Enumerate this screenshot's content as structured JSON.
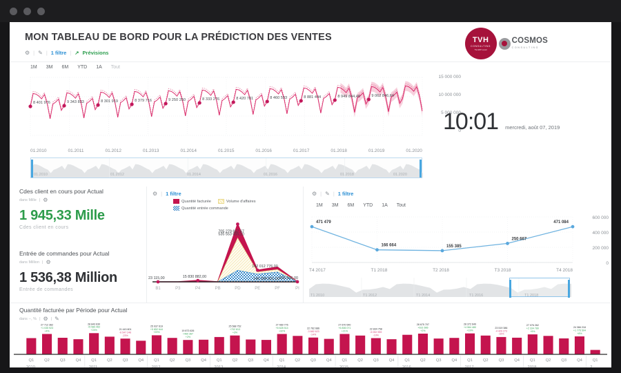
{
  "window": {
    "dots": [
      "close",
      "minimize",
      "maximize"
    ]
  },
  "header": {
    "title": "MON TABLEAU DE BORD POUR LA PRÉDICTION DES VENTES",
    "toolbar": {
      "gear_icon": "gear-icon",
      "edit_icon": "pencil-icon",
      "filter_label": "1 filtre",
      "forecast_icon": "trend-up-icon",
      "forecast_label": "Prévisions",
      "separator": "|"
    },
    "brand": {
      "tvh_line1": "TVH",
      "tvh_line2": "CONSULTING",
      "tvh_line3": "The ERP expert",
      "cosmos_line1": "COSMOS",
      "cosmos_line2": "CONSULTING"
    }
  },
  "clock": {
    "time": "10:01",
    "date": "mercredi, août 07, 2019"
  },
  "range_tabs": [
    "1M",
    "3M",
    "6M",
    "YTD",
    "1A",
    "Tout"
  ],
  "range_tabs_active_index": 5,
  "kpi_cards": [
    {
      "title": "Cdes client en cours pour Actual",
      "unit": "dans Mille",
      "gear_icon": "gear-icon",
      "value": "1 945,33 Mille",
      "caption": "Cdes client en cours",
      "color": "#2d9c4b"
    },
    {
      "title": "Entrée de commandes pour Actual",
      "unit": "dans Million",
      "gear_icon": "gear-icon",
      "value": "1 536,38 Million",
      "caption": "Entrée de commandes",
      "color": "#2f3135"
    }
  ],
  "mid_panel": {
    "gear_icon": "gear-icon",
    "filter_label": "1 filtre",
    "separator": "|"
  },
  "right_panel": {
    "gear_icon": "gear-icon",
    "edit_icon": "pencil-icon",
    "filter_label": "1 filtre",
    "separator": "|"
  },
  "bottom_panel": {
    "title": "Quantité facturée par Période pour Actual",
    "unit": "dans --, %",
    "gear_icon": "gear-icon",
    "edit_icon": "pencil-icon"
  },
  "chart_data": [
    {
      "id": "forecast-timeseries",
      "type": "line",
      "title": "",
      "xlabel": "",
      "ylabel": "",
      "ylim": [
        0,
        15000000
      ],
      "yticks": [
        "0",
        "5 000 000",
        "10 000 000",
        "15 000 000"
      ],
      "xticks": [
        "01.2010",
        "01.2011",
        "01.2012",
        "01.2013",
        "01.2014",
        "01.2015",
        "01.2016",
        "01.2017",
        "01.2018",
        "01.2019",
        "01.2020"
      ],
      "grid": true,
      "series": [
        {
          "name": "Actual",
          "color": "#d81b60"
        },
        {
          "name": "Prévisions",
          "color": "#e8a3bd",
          "style": "dashed-band"
        }
      ],
      "point_labels": [
        "8 401 976",
        "9 343 833",
        "8 301 919",
        "8 379 716",
        "9 250 250",
        "8 333 276",
        "8 420 781",
        "8 460 593",
        "8 881 444",
        "8 949 844,48",
        "9 062 846,64"
      ],
      "navigator": {
        "xticks": [
          "01.2010",
          "01.2012",
          "01.2014",
          "01.2016",
          "01.2018",
          "01.2020"
        ],
        "selected_full": true
      }
    },
    {
      "id": "quantite-par-canal",
      "type": "area",
      "categories": [
        "B1",
        "P3",
        "P4",
        "PB",
        "PD",
        "PE",
        "PF",
        "PI"
      ],
      "legend": [
        {
          "label": "Quantité facturée",
          "color": "#c4144e",
          "pattern": "solid"
        },
        {
          "label": "Volume d'affaires",
          "color": "#f7e9b0",
          "pattern": "diagonal-hatch"
        },
        {
          "label": "Quantité entrée commande",
          "color": "#2f7fc4",
          "pattern": "checker"
        }
      ],
      "legend_position": "top",
      "data_labels": [
        "23 115,00",
        "15 830 882,00",
        "535 553 655,10",
        "705 279 657,67",
        "142 012 776,00",
        "140 394 001,00",
        "836 536,00"
      ],
      "series": [
        {
          "name": "Quantité facturée",
          "values": [
            23115,
            0,
            15830882,
            0,
            705279657,
            142012776,
            180000000,
            836536
          ]
        },
        {
          "name": "Volume d'affaires",
          "values": [
            0,
            0,
            0,
            0,
            535553655,
            120000000,
            150000000,
            0
          ]
        },
        {
          "name": "Quantité entrée commande",
          "values": [
            0,
            0,
            0,
            0,
            140394001,
            95000000,
            120000000,
            0
          ]
        }
      ],
      "ylim": [
        0,
        760000000
      ]
    },
    {
      "id": "quarterly-trend",
      "type": "line",
      "categories": [
        "T4 2017",
        "T1 2018",
        "T2 2018",
        "T3 2018",
        "T4 2018"
      ],
      "values": [
        471479,
        166664,
        155385,
        250667,
        471084
      ],
      "value_labels": [
        "471 479",
        "166 664",
        "155 385",
        "250 667",
        "471 084"
      ],
      "yticks": [
        "0",
        "200 000",
        "400 000",
        "600 000"
      ],
      "ylim": [
        0,
        600000
      ],
      "color": "#6fb3e0",
      "grid": true,
      "navigator": {
        "xticks": [
          "T1 2010",
          "T1 2012",
          "T1 2014",
          "T1 2016",
          "T1 2018"
        ],
        "selection_label": "T1 2018"
      }
    },
    {
      "id": "quantite-facturee-par-periode",
      "type": "bar",
      "title": "Quantité facturée par Période pour Actual",
      "bar_color": "#c4144e",
      "years": [
        "2010",
        "2011",
        "2012",
        "2013",
        "2014",
        "2015",
        "2016",
        "2017",
        "2018",
        "2..."
      ],
      "quarters": [
        "Q1",
        "Q2",
        "Q3",
        "Q4"
      ],
      "categories": [
        "Q1 2010",
        "Q2 2010",
        "Q3 2010",
        "Q4 2010",
        "Q1 2011",
        "Q2 2011",
        "Q3 2011",
        "Q4 2011",
        "Q1 2012",
        "Q2 2012",
        "Q3 2012",
        "Q4 2012",
        "Q1 2013",
        "Q2 2013",
        "Q3 2013",
        "Q4 2013",
        "Q1 2014",
        "Q2 2014",
        "Q3 2014",
        "Q4 2014",
        "Q1 2015",
        "Q2 2015",
        "Q3 2015",
        "Q4 2015",
        "Q1 2016",
        "Q2 2016",
        "Q3 2016",
        "Q4 2016",
        "Q1 2017",
        "Q2 2017",
        "Q3 2017",
        "Q4 2017",
        "Q1 2018",
        "Q2 2018",
        "Q3 2018",
        "Q4 2018",
        "Q1 2019"
      ],
      "values": [
        22.0,
        27.7,
        22.5,
        20.5,
        28.8,
        24.0,
        21.4,
        18.5,
        25.9,
        22.3,
        19.5,
        19.9,
        23.5,
        25.6,
        20.2,
        19.6,
        27.7,
        25.0,
        22.8,
        21.0,
        27.7,
        25.5,
        22.0,
        20.5,
        26.5,
        28.1,
        21.5,
        22.3,
        28.4,
        25.5,
        23.5,
        22.6,
        27.1,
        25.0,
        21.7,
        24.4,
        6.0
      ],
      "annotations": [
        {
          "index": 1,
          "value": "27 712 362",
          "delta": "+1 035 923",
          "pct": "+4%",
          "positive": true
        },
        {
          "index": 4,
          "value": "28 843 630",
          "delta": "+5 589 462",
          "pct": "+24%",
          "positive": true
        },
        {
          "index": 6,
          "value": "21 443 801",
          "delta": "-6 547 246",
          "pct": "-23%",
          "positive": false
        },
        {
          "index": 8,
          "value": "25 937 619",
          "delta": "+5 852 644",
          "pct": "+29%",
          "positive": true
        },
        {
          "index": 10,
          "value": "19 873 626",
          "delta": "+460 367",
          "pct": "+2%",
          "positive": true
        },
        {
          "index": 13,
          "value": "25 588 752",
          "delta": "+702 813",
          "pct": "+3%",
          "positive": true
        },
        {
          "index": 16,
          "value": "27 489 776",
          "delta": "+6 628 514",
          "pct": "+32%",
          "positive": true
        },
        {
          "index": 18,
          "value": "22 762 686",
          "delta": "-3 682 623",
          "pct": "-14%",
          "positive": false
        },
        {
          "index": 20,
          "value": "27 670 540",
          "delta": "+6 806 071",
          "pct": "+21%",
          "positive": true
        },
        {
          "index": 22,
          "value": "22 834 758",
          "delta": "-5 052 959",
          "pct": "-19%",
          "positive": false
        },
        {
          "index": 25,
          "value": "28 675 707",
          "delta": "+631 666",
          "pct": "+2%",
          "positive": true
        },
        {
          "index": 28,
          "value": "28 372 649",
          "delta": "+4 564 480",
          "pct": "+19%",
          "positive": true
        },
        {
          "index": 30,
          "value": "23 519 386",
          "delta": "-4 429 273",
          "pct": "-16%",
          "positive": false
        },
        {
          "index": 32,
          "value": "27 076 262",
          "delta": "+2 334 780",
          "pct": "+9%",
          "positive": true
        },
        {
          "index": 35,
          "value": "24 366 218",
          "delta": "+1 775 504",
          "pct": "+8%",
          "positive": true
        }
      ]
    }
  ]
}
